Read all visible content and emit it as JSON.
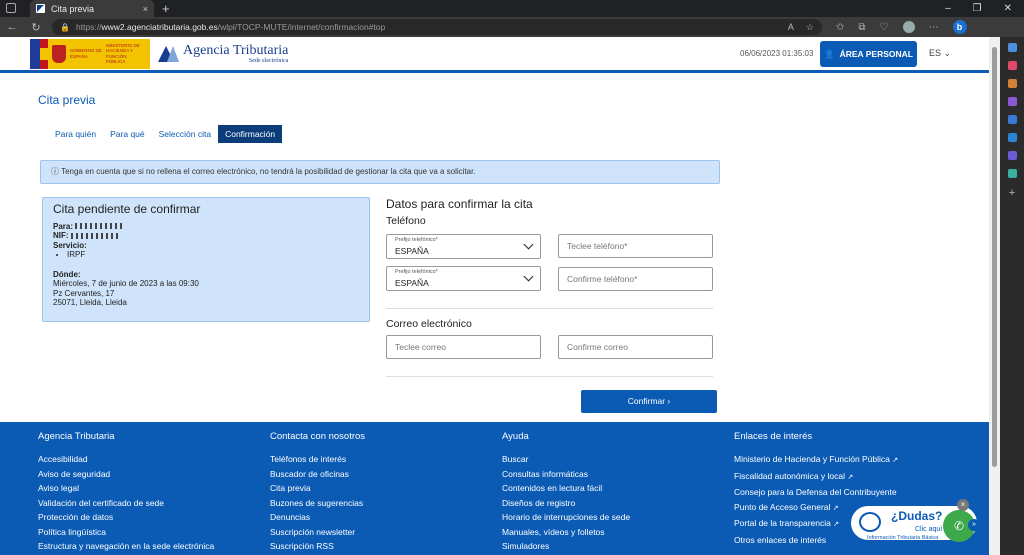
{
  "browser": {
    "tab_title": "Cita previa",
    "tab_close": "×",
    "new_tab": "+",
    "url_prefix": "https://",
    "url_host": "www2.agenciatributaria.gob.es",
    "url_path": "/wlpl/TOCP-MUTE/internet/confirmacion#top",
    "win_min": "–",
    "win_max": "❐",
    "win_close": "✕"
  },
  "header": {
    "gov_line1": "GOBIERNO DE ESPAÑA",
    "gov_line2": "MINISTERIO DE HACIENDA Y FUNCIÓN PÚBLICA",
    "brand_name": "Agencia Tributaria",
    "brand_sub": "Sede electrónica",
    "datetime": "06/06/2023 01:35:03",
    "area_button": "ÁREA PERSONAL",
    "language": "ES"
  },
  "page_title": "Cita previa",
  "steps": [
    {
      "label": "Para quién"
    },
    {
      "label": "Para qué"
    },
    {
      "label": "Selección cita"
    },
    {
      "label": "Confirmación"
    }
  ],
  "alert_text": "Tenga en cuenta que si no rellena el correo electrónico, no tendrá la posibilidad de gestionar la cita que va a solicitar.",
  "summary": {
    "title": "Cita pendiente de confirmar",
    "para_label": "Para:",
    "nif_label": "NIF:",
    "servicio_label": "Servicio:",
    "servicio_value": "IRPF",
    "donde_label": "Dónde:",
    "fecha": "Miércoles, 7 de junio de 2023 a las 09:30",
    "direccion1": "Pz Cervantes, 17",
    "direccion2": "25071, Lleida, Lleida"
  },
  "form": {
    "title": "Datos para confirmar la cita",
    "telefono_heading": "Teléfono",
    "prefijo_label": "Prefijo telefónico*",
    "prefijo_value": "ESPAÑA",
    "telefono_placeholder": "Teclee teléfono*",
    "confirme_telefono_placeholder": "Confirme teléfono*",
    "correo_heading": "Correo electrónico",
    "correo_placeholder": "Teclee correo",
    "confirme_correo_placeholder": "Confirme correo",
    "confirm_button": "Confirmar ›"
  },
  "footer": {
    "col1": {
      "heading": "Agencia Tributaria",
      "links": [
        "Accesibilidad",
        "Aviso de seguridad",
        "Aviso legal",
        "Validación del certificado de sede",
        "Protección de datos",
        "Política lingüística",
        "Estructura y navegación en la sede electrónica"
      ]
    },
    "col2": {
      "heading": "Contacta con nosotros",
      "links": [
        "Teléfonos de interés",
        "Buscador de oficinas",
        "Cita previa",
        "Buzones de sugerencias",
        "Denuncias",
        "Suscripción newsletter",
        "Suscripción RSS"
      ]
    },
    "col3": {
      "heading": "Ayuda",
      "links": [
        "Buscar",
        "Consultas informáticas",
        "Contenidos en lectura fácil",
        "Diseños de registro",
        "Horario de interrupciones de sede",
        "Manuales, vídeos y folletos",
        "Simuladores"
      ]
    },
    "col4": {
      "heading": "Enlaces de interés",
      "links": [
        "Ministerio de Hacienda y Función Pública",
        "Fiscalidad autonómica y local",
        "Consejo para la Defensa del Contribuyente",
        "Punto de Acceso General",
        "Portal de la transparencia",
        "Otros enlaces de interés"
      ]
    }
  },
  "dudas": {
    "title": "¿Dudas?",
    "clic": "Clic aquí",
    "info": "Información Tributaria Básica",
    "close": "×",
    "toggle": "»"
  }
}
